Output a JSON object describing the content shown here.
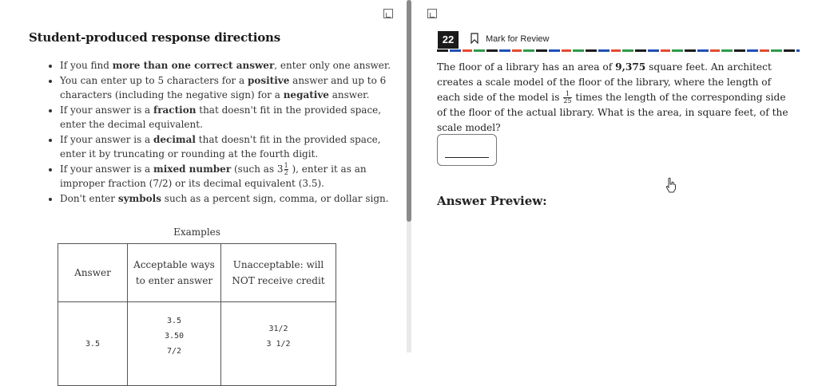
{
  "directions": {
    "title": "Student-produced response directions",
    "rules": [
      {
        "pre": "If you find ",
        "bold": "more than one correct answer",
        "post": ", enter only one answer."
      },
      {
        "pre": "You can enter up to 5 characters for a ",
        "bold": "positive",
        "mid": " answer and up to 6 characters (including the negative sign) for a ",
        "bold2": "negative",
        "post": " answer."
      },
      {
        "pre": "If your answer is a ",
        "bold": "fraction",
        "post": " that doesn't fit in the provided space, enter the decimal equivalent."
      },
      {
        "pre": "If your answer is a ",
        "bold": "decimal",
        "post": " that doesn't fit in the provided space, enter it by truncating or rounding at the fourth digit."
      },
      {
        "pre": "If your answer is a ",
        "bold": "mixed number",
        "mid": " (such as 3",
        "frac_num": "1",
        "frac_den": "2",
        "post": " ), enter it as an improper fraction (7/2) or its decimal equivalent (3.5)."
      },
      {
        "pre": "Don't enter ",
        "bold": "symbols",
        "post": " such as a percent sign, comma, or dollar sign."
      }
    ]
  },
  "examples": {
    "caption": "Examples",
    "headers": [
      "Answer",
      "Acceptable ways to enter answer",
      "Unacceptable: will NOT receive credit"
    ],
    "row": {
      "answer": "3.5",
      "acceptable": [
        "3.5",
        "3.50",
        "7/2"
      ],
      "unacceptable": [
        "31/2",
        "3 1/2"
      ]
    }
  },
  "question": {
    "number": "22",
    "mark_label": "Mark for Review",
    "text_1": "The floor of a library has an area of ",
    "area": "9,375",
    "text_2": " square feet. An architect creates a scale model of the floor of the library, where the length of each side of the model is ",
    "frac_num": "1",
    "frac_den": "25",
    "text_3": " times the length of the corresponding side of the floor of the actual library. What is the area, in square feet, of the scale model?",
    "answer_value": "",
    "preview_label": "Answer Preview:"
  },
  "icons": {
    "expand_left": "expand-icon",
    "expand_right": "collapse-icon",
    "bookmark": "bookmark-icon",
    "cursor": "hand-pointer-icon"
  }
}
